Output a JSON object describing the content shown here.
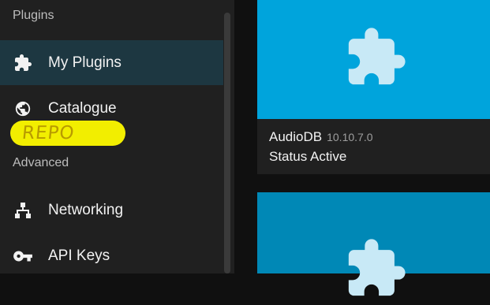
{
  "sidebar": {
    "section_plugins": "Plugins",
    "section_advanced": "Advanced",
    "items": [
      {
        "label": "My Plugins",
        "icon": "puzzle-icon",
        "active": true
      },
      {
        "label": "Catalogue",
        "icon": "globe-icon",
        "active": false
      },
      {
        "label": "Networking",
        "icon": "network-icon",
        "active": false
      },
      {
        "label": "API Keys",
        "icon": "key-icon",
        "active": false
      }
    ],
    "annotation": "REPO"
  },
  "plugins": [
    {
      "name": "AudioDB",
      "version": "10.10.7.0",
      "status": "Status Active",
      "image_color": "#00a4dc",
      "icon": "puzzle-icon"
    },
    {
      "name": "",
      "version": "",
      "status": "",
      "image_color": "#0088b6",
      "icon": "puzzle-icon"
    }
  ],
  "colors": {
    "accent": "#00a4dc",
    "active_item_bg": "#1d3741",
    "sidebar_bg": "#202020",
    "highlight": "#f2ee00"
  }
}
